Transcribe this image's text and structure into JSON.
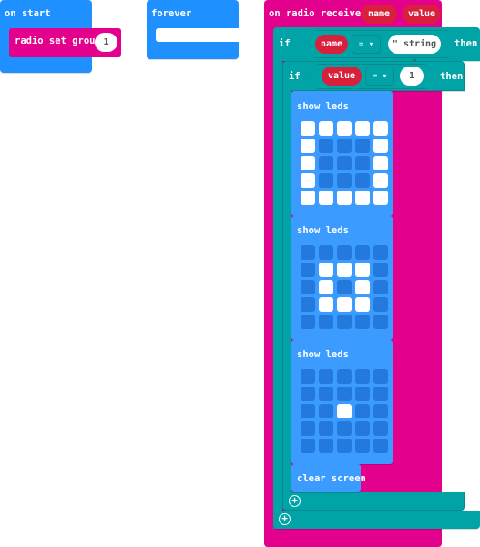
{
  "blocks": {
    "on_start": {
      "label": "on start",
      "inner": {
        "label": "radio set group",
        "value": "1"
      }
    },
    "forever": {
      "label": "forever"
    },
    "on_radio_received": {
      "label": "on radio received",
      "params": [
        "name",
        "value"
      ],
      "outer_if": {
        "if_label": "if",
        "then_label": "then",
        "left": "name",
        "operator": "= ▾",
        "right": "\" string \""
      },
      "inner_if": {
        "if_label": "if",
        "then_label": "then",
        "left": "value",
        "operator": "= ▾",
        "right": "1"
      },
      "show_leds": [
        {
          "label": "show leds",
          "grid": [
            [
              1,
              1,
              1,
              1,
              1
            ],
            [
              1,
              0,
              0,
              0,
              1
            ],
            [
              1,
              0,
              0,
              0,
              1
            ],
            [
              1,
              0,
              0,
              0,
              1
            ],
            [
              1,
              1,
              1,
              1,
              1
            ]
          ]
        },
        {
          "label": "show leds",
          "grid": [
            [
              0,
              0,
              0,
              0,
              0
            ],
            [
              0,
              1,
              1,
              1,
              0
            ],
            [
              0,
              1,
              0,
              1,
              0
            ],
            [
              0,
              1,
              1,
              1,
              0
            ],
            [
              0,
              0,
              0,
              0,
              0
            ]
          ]
        },
        {
          "label": "show leds",
          "grid": [
            [
              0,
              0,
              0,
              0,
              0
            ],
            [
              0,
              0,
              0,
              0,
              0
            ],
            [
              0,
              0,
              1,
              0,
              0
            ],
            [
              0,
              0,
              0,
              0,
              0
            ],
            [
              0,
              0,
              0,
              0,
              0
            ]
          ]
        }
      ],
      "clear_screen": "clear screen"
    }
  },
  "icons": {
    "add": "plus-circle-icon"
  },
  "colors": {
    "basic": "#1e90ff",
    "radio": "#e3008c",
    "logic": "#00a4a6",
    "variable": "#d8203d"
  }
}
